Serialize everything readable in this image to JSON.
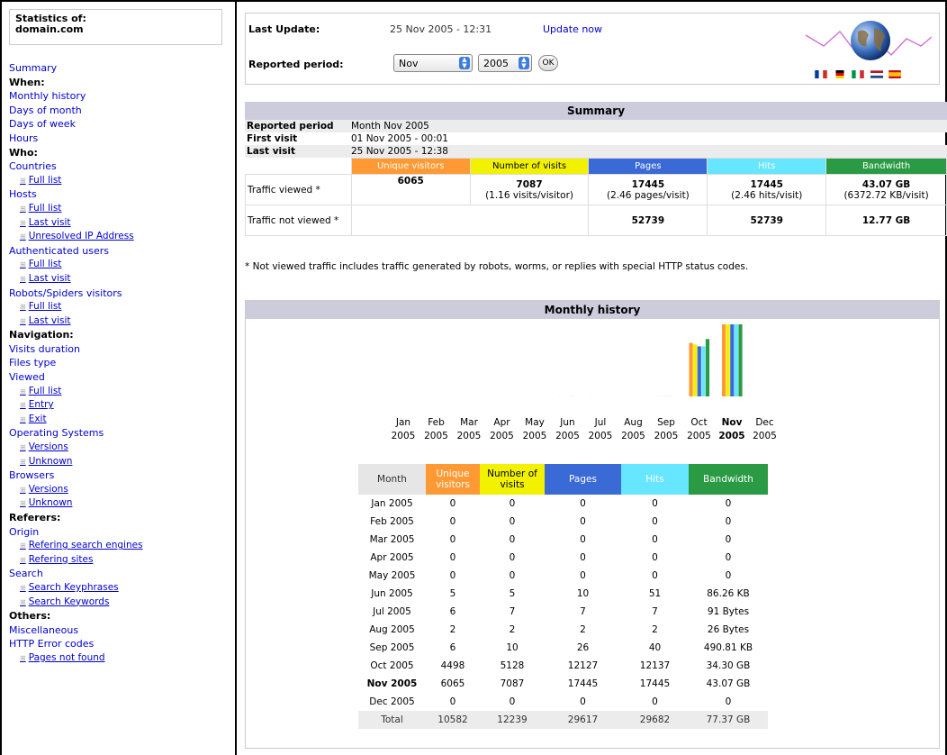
{
  "menu": {
    "stats_title": "Statistics of:",
    "stats_domain": "domain.com",
    "items": [
      {
        "type": "link",
        "label": "Summary"
      },
      {
        "type": "head",
        "label": "When:"
      },
      {
        "type": "link",
        "label": "Monthly history"
      },
      {
        "type": "link",
        "label": "Days of month"
      },
      {
        "type": "link",
        "label": "Days of week"
      },
      {
        "type": "link",
        "label": "Hours"
      },
      {
        "type": "head",
        "label": "Who:"
      },
      {
        "type": "link",
        "label": "Countries"
      },
      {
        "type": "sub",
        "label": "Full list"
      },
      {
        "type": "link",
        "label": "Hosts"
      },
      {
        "type": "sub",
        "label": "Full list"
      },
      {
        "type": "sub",
        "label": "Last visit"
      },
      {
        "type": "sub",
        "label": "Unresolved IP Address"
      },
      {
        "type": "link",
        "label": "Authenticated users"
      },
      {
        "type": "sub",
        "label": "Full list"
      },
      {
        "type": "sub",
        "label": "Last visit"
      },
      {
        "type": "link",
        "label": "Robots/Spiders visitors"
      },
      {
        "type": "sub",
        "label": "Full list"
      },
      {
        "type": "sub",
        "label": "Last visit"
      },
      {
        "type": "head",
        "label": "Navigation:"
      },
      {
        "type": "link",
        "label": "Visits duration"
      },
      {
        "type": "link",
        "label": "Files type"
      },
      {
        "type": "link",
        "label": "Viewed"
      },
      {
        "type": "sub",
        "label": "Full list"
      },
      {
        "type": "sub",
        "label": "Entry"
      },
      {
        "type": "sub",
        "label": "Exit"
      },
      {
        "type": "link",
        "label": "Operating Systems"
      },
      {
        "type": "sub",
        "label": "Versions"
      },
      {
        "type": "sub",
        "label": "Unknown"
      },
      {
        "type": "link",
        "label": "Browsers"
      },
      {
        "type": "sub",
        "label": "Versions"
      },
      {
        "type": "sub",
        "label": "Unknown"
      },
      {
        "type": "head",
        "label": "Referers:"
      },
      {
        "type": "link",
        "label": "Origin"
      },
      {
        "type": "sub",
        "label": "Refering search engines"
      },
      {
        "type": "sub",
        "label": "Refering sites"
      },
      {
        "type": "link",
        "label": "Search"
      },
      {
        "type": "sub",
        "label": "Search Keyphrases"
      },
      {
        "type": "sub",
        "label": "Search Keywords"
      },
      {
        "type": "head",
        "label": "Others:"
      },
      {
        "type": "link",
        "label": "Miscellaneous"
      },
      {
        "type": "link",
        "label": "HTTP Error codes"
      },
      {
        "type": "sub",
        "label": "Pages not found"
      }
    ]
  },
  "topbar": {
    "last_update_label": "Last Update:",
    "last_update_value": "25 Nov 2005 - 12:31",
    "update_now": "Update now",
    "period_label": "Reported period:",
    "month_select": "Nov",
    "year_select": "2005",
    "ok": "OK"
  },
  "colors": {
    "unique": "#ff9933",
    "visits": "#f2f200",
    "pages": "#3a6ad6",
    "hits": "#66e6ff",
    "bandwidth": "#2a9a44",
    "section": "#ccccdd"
  },
  "summary": {
    "title": "Summary",
    "reported_label": "Reported period",
    "reported_value": "Month Nov 2005",
    "first_label": "First visit",
    "first_value": "01 Nov 2005 - 00:01",
    "last_label": "Last visit",
    "last_value": "25 Nov 2005 - 12:38",
    "headers": [
      "Unique visitors",
      "Number of visits",
      "Pages",
      "Hits",
      "Bandwidth"
    ],
    "viewed_label": "Traffic viewed *",
    "viewed": [
      "6065",
      "7087",
      "17445",
      "17445",
      "43.07 GB"
    ],
    "viewed_sub": [
      "",
      "(1.16 visits/visitor)",
      "(2.46 pages/visit)",
      "(2.46 hits/visit)",
      "(6372.72 KB/visit)"
    ],
    "not_viewed_label": "Traffic not viewed *",
    "not_viewed": [
      "",
      "",
      "52739",
      "52739",
      "12.77 GB"
    ],
    "note": "* Not viewed traffic includes traffic generated by robots, worms, or replies with special HTTP status codes."
  },
  "monthly": {
    "title": "Monthly history",
    "headers": [
      "Month",
      "Unique visitors",
      "Number of visits",
      "Pages",
      "Hits",
      "Bandwidth"
    ],
    "rows": [
      [
        "Jan 2005",
        "0",
        "0",
        "0",
        "0",
        "0"
      ],
      [
        "Feb 2005",
        "0",
        "0",
        "0",
        "0",
        "0"
      ],
      [
        "Mar 2005",
        "0",
        "0",
        "0",
        "0",
        "0"
      ],
      [
        "Apr 2005",
        "0",
        "0",
        "0",
        "0",
        "0"
      ],
      [
        "May 2005",
        "0",
        "0",
        "0",
        "0",
        "0"
      ],
      [
        "Jun 2005",
        "5",
        "5",
        "10",
        "51",
        "86.26 KB"
      ],
      [
        "Jul 2005",
        "6",
        "7",
        "7",
        "7",
        "91 Bytes"
      ],
      [
        "Aug 2005",
        "2",
        "2",
        "2",
        "2",
        "26 Bytes"
      ],
      [
        "Sep 2005",
        "6",
        "10",
        "26",
        "40",
        "490.81 KB"
      ],
      [
        "Oct 2005",
        "4498",
        "5128",
        "12127",
        "12137",
        "34.30 GB"
      ],
      [
        "Nov 2005",
        "6065",
        "7087",
        "17445",
        "17445",
        "43.07 GB"
      ],
      [
        "Dec 2005",
        "0",
        "0",
        "0",
        "0",
        "0"
      ]
    ],
    "current_row": 10,
    "total": [
      "Total",
      "10582",
      "12239",
      "29617",
      "29682",
      "77.37 GB"
    ]
  },
  "chart_data": {
    "type": "bar",
    "categories": [
      "Jan 2005",
      "Feb 2005",
      "Mar 2005",
      "Apr 2005",
      "May 2005",
      "Jun 2005",
      "Jul 2005",
      "Aug 2005",
      "Sep 2005",
      "Oct 2005",
      "Nov 2005",
      "Dec 2005"
    ],
    "cat_month": [
      "Jan",
      "Feb",
      "Mar",
      "Apr",
      "May",
      "Jun",
      "Jul",
      "Aug",
      "Sep",
      "Oct",
      "Nov",
      "Dec"
    ],
    "cat_year": [
      "2005",
      "2005",
      "2005",
      "2005",
      "2005",
      "2005",
      "2005",
      "2005",
      "2005",
      "2005",
      "2005",
      "2005"
    ],
    "highlight_index": 10,
    "series": [
      {
        "name": "Unique visitors",
        "values": [
          0,
          0,
          0,
          0,
          0,
          5,
          6,
          2,
          6,
          4498,
          6065,
          0
        ]
      },
      {
        "name": "Number of visits",
        "values": [
          0,
          0,
          0,
          0,
          0,
          5,
          7,
          2,
          10,
          5128,
          7087,
          0
        ]
      },
      {
        "name": "Pages",
        "values": [
          0,
          0,
          0,
          0,
          0,
          10,
          7,
          2,
          26,
          12127,
          17445,
          0
        ]
      },
      {
        "name": "Hits",
        "values": [
          0,
          0,
          0,
          0,
          0,
          51,
          7,
          2,
          40,
          12137,
          17445,
          0
        ]
      },
      {
        "name": "Bandwidth (GB)",
        "values": [
          0,
          0,
          0,
          0,
          0,
          0.0001,
          0,
          0,
          0.0005,
          34.3,
          43.07,
          0
        ]
      }
    ],
    "grid": false
  }
}
